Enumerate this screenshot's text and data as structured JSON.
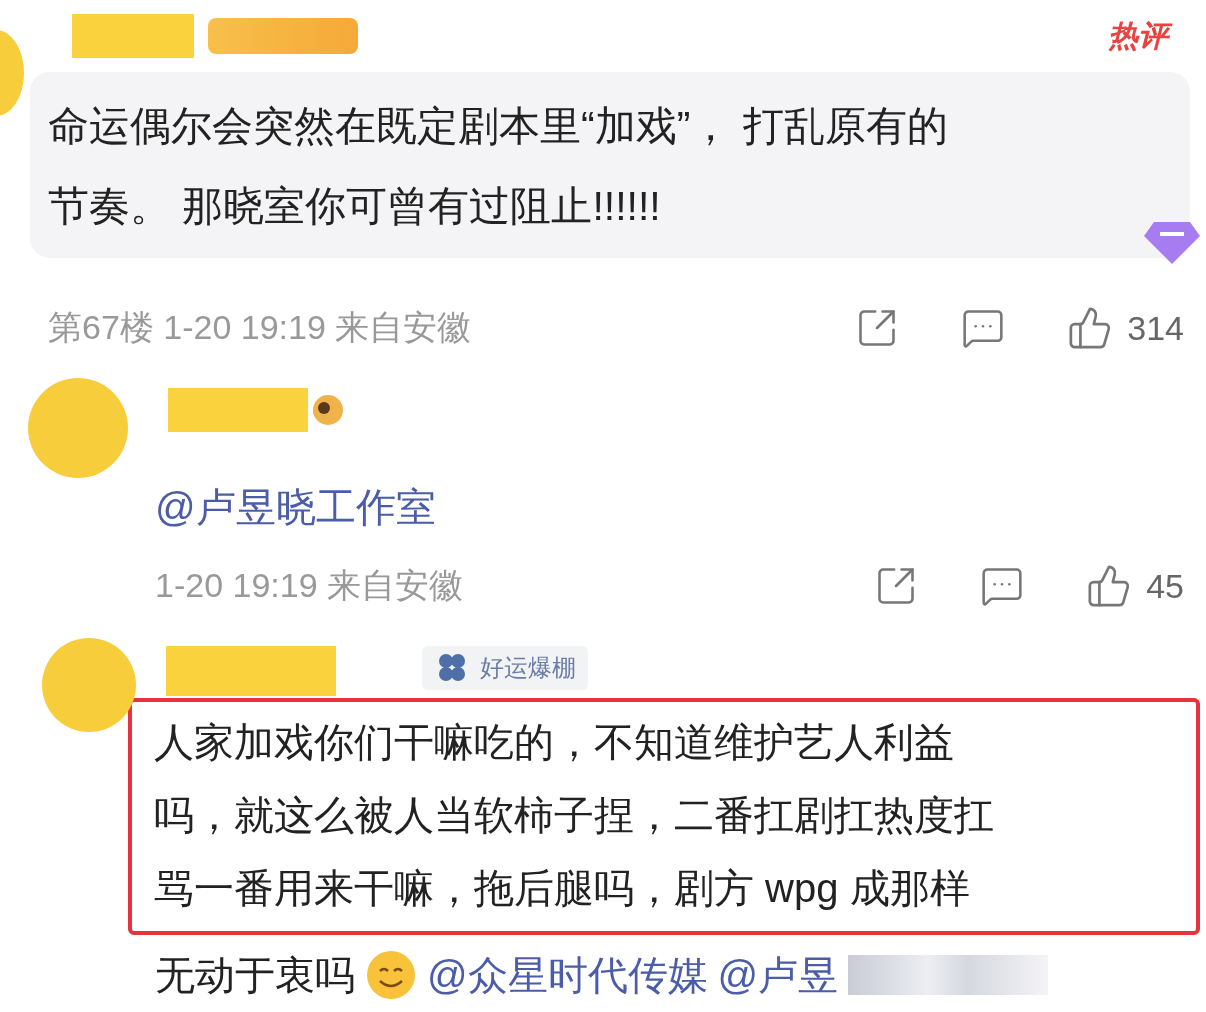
{
  "hot_comment": {
    "tag": "热评",
    "lines": [
      "命运偶尔会突然在既定剧本里“加戏”， 打乱原有的",
      "节奏。 那晓室你可曾有过阻止!!!!!!"
    ],
    "meta": "第67楼 1-20 19:19 来自安徽",
    "likes": "314"
  },
  "reply": {
    "mention": "@卢昱晓工作室",
    "meta": "1-20 19:19 来自安徽",
    "likes": "45"
  },
  "last_reply": {
    "badge": "好运爆棚",
    "highlighted_lines": [
      "人家加戏你们干嘛吃的，不知道维护艺人利益",
      "吗，就这么被人当软柿子捏，二番扛剧扛热度扛",
      "骂一番用来干嘛，拖后腿吗，剧方 wpg 成那样"
    ],
    "tail": "无动于衷吗",
    "mentions": [
      "@众星时代传媒",
      "@卢昱"
    ]
  }
}
